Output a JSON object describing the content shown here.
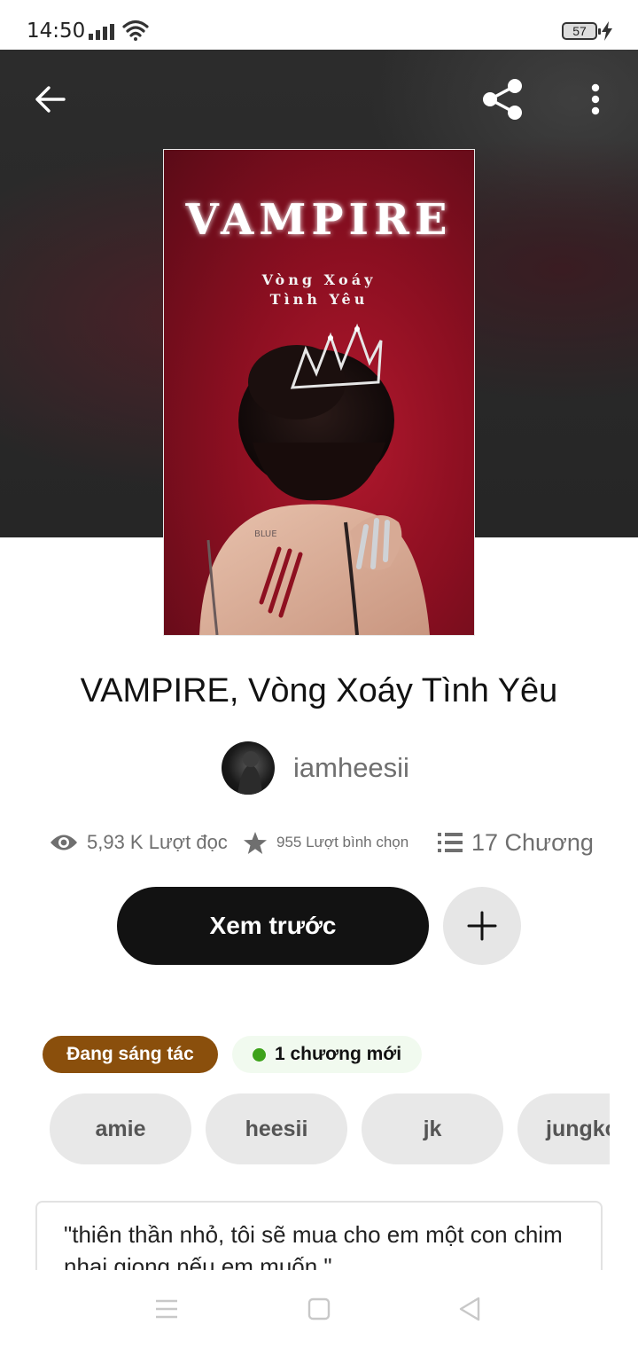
{
  "status_bar": {
    "time": "14:50",
    "battery": "57"
  },
  "book": {
    "title": "VAMPIRE, Vòng Xoáy Tình Yêu",
    "cover": {
      "title": "VAMPIRE",
      "subtitle_line1": "Vòng Xoáy",
      "subtitle_line2": "Tình Yêu",
      "tattoo": "BLUE"
    },
    "author": "iamheesii"
  },
  "stats": {
    "reads": "5,93 K Lượt đọc",
    "votes": "955 Lượt bình chọn",
    "chapters": "17 Chương"
  },
  "actions": {
    "preview_label": "Xem trước"
  },
  "badges": {
    "status": "Đang sáng tác",
    "new_chapters": "1 chương mới"
  },
  "tags": [
    "amie",
    "heesii",
    "jk",
    "jungko"
  ],
  "description": "\"thiên thần nhỏ, tôi sẽ mua cho em một con chim nhại giọng nếu em muốn.\"",
  "colors": {
    "accent_dark": "#121212",
    "status_badge": "#8a4f0c",
    "new_dot": "#3da21a",
    "cover_red": "#8c0f21"
  }
}
